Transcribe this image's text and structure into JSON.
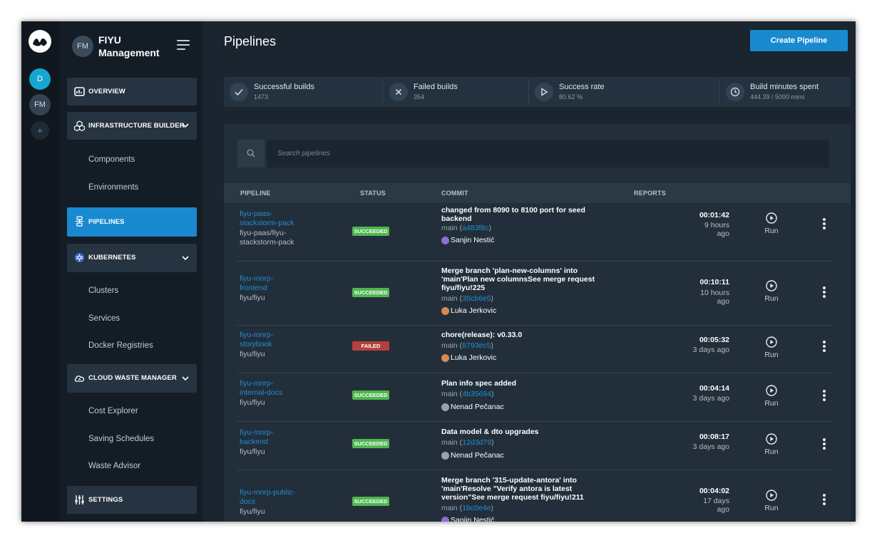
{
  "rail": {
    "workspaces": [
      "D",
      "FM"
    ],
    "add_label": "+"
  },
  "sidebar": {
    "org_initials": "FM",
    "org_name": "FIYU Management",
    "nav": {
      "overview": "OVERVIEW",
      "infrastructure_builder": "INFRASTRUCTURE BUILDER",
      "components": "Components",
      "environments": "Environments",
      "pipelines": "PIPELINES",
      "kubernetes": "KUBERNETES",
      "clusters": "Clusters",
      "services": "Services",
      "docker_registries": "Docker Registries",
      "cloud_waste_manager": "CLOUD WASTE MANAGER",
      "cost_explorer": "Cost Explorer",
      "saving_schedules": "Saving Schedules",
      "waste_advisor": "Waste Advisor",
      "settings": "SETTINGS"
    },
    "active_item": "pipelines"
  },
  "header": {
    "title": "Pipelines",
    "create_button": "Create Pipeline"
  },
  "stats": [
    {
      "icon": "check-icon",
      "label": "Successful builds",
      "value": "1473"
    },
    {
      "icon": "x-icon",
      "label": "Failed builds",
      "value": "354"
    },
    {
      "icon": "play-icon",
      "label": "Success rate",
      "value": "80.62 %"
    },
    {
      "icon": "clock-icon",
      "label": "Build minutes spent",
      "value": "444.39 / 5000 mins"
    }
  ],
  "search": {
    "placeholder": "Search pipelines",
    "value": ""
  },
  "table": {
    "columns": [
      "PIPELINE",
      "STATUS",
      "COMMIT",
      "REPORTS"
    ],
    "rows": [
      {
        "name_lines": [
          "fiyu-paas-",
          "stackstorm-pack"
        ],
        "repo_lines": [
          "fiyu-paas/fiyu-",
          "stackstorm-pack"
        ],
        "status": "SUCCEEDED",
        "commit_lines": [
          "changed from 8090 to 8100 port for seed",
          "backend"
        ],
        "branch": "main",
        "hash": "a483f8c",
        "author": "Sanjin Nestić",
        "author_color": "#8b6fd6",
        "duration": "00:01:42",
        "ago_lines": [
          "9 hours",
          "ago"
        ],
        "run_label": "Run"
      },
      {
        "name_lines": [
          "fiyu-mnrp-",
          "frontend"
        ],
        "repo_lines": [
          "fiyu/fiyu"
        ],
        "status": "SUCCEEDED",
        "commit_lines": [
          "Merge branch 'plan-new-columns' into",
          "'main'Plan new columnsSee merge request",
          "fiyu/fiyu!225"
        ],
        "branch": "main",
        "hash": "35cb6e5",
        "author": "Luka Jerkovic",
        "author_color": "#d68a4f",
        "duration": "00:10:11",
        "ago_lines": [
          "10 hours",
          "ago"
        ],
        "run_label": "Run"
      },
      {
        "name_lines": [
          "fiyu-mnrp-",
          "storybook"
        ],
        "repo_lines": [
          "fiyu/fiyu"
        ],
        "status": "FAILED",
        "commit_lines": [
          "chore(release): v0.33.0"
        ],
        "branch": "main",
        "hash": "8793ec5",
        "author": "Luka Jerkovic",
        "author_color": "#d68a4f",
        "duration": "00:05:32",
        "ago_lines": [
          "3 days ago"
        ],
        "run_label": "Run"
      },
      {
        "name_lines": [
          "fiyu-mnrp-",
          "internal-docs"
        ],
        "repo_lines": [
          "fiyu/fiyu"
        ],
        "status": "SUCCEEDED",
        "commit_lines": [
          "Plan info spec added"
        ],
        "branch": "main",
        "hash": "4b35694",
        "author": "Nenad Pečanac",
        "author_color": "#9aa1a8",
        "duration": "00:04:14",
        "ago_lines": [
          "3 days ago"
        ],
        "run_label": "Run"
      },
      {
        "name_lines": [
          "fiyu-mnrp-",
          "backend"
        ],
        "repo_lines": [
          "fiyu/fiyu"
        ],
        "status": "SUCCEEDED",
        "commit_lines": [
          "Data model & dto upgrades"
        ],
        "branch": "main",
        "hash": "12d3d79",
        "author": "Nenad Pečanac",
        "author_color": "#9aa1a8",
        "duration": "00:08:17",
        "ago_lines": [
          "3 days ago"
        ],
        "run_label": "Run"
      },
      {
        "name_lines": [
          "fiyu-mnrp-public-",
          "docs"
        ],
        "repo_lines": [
          "fiyu/fiyu"
        ],
        "status": "SUCCEEDED",
        "commit_lines": [
          "Merge branch '315-update-antora' into",
          "'main'Resolve \"Verify antora is latest",
          "version\"See merge request fiyu/fiyu!211"
        ],
        "branch": "main",
        "hash": "1bc0e4e",
        "author": "Sanjin Nestić",
        "author_color": "#8b6fd6",
        "duration": "00:04:02",
        "ago_lines": [
          "17 days",
          "ago"
        ],
        "run_label": "Run"
      }
    ]
  },
  "colors": {
    "accent": "#1a8ad0",
    "succeeded": "#4fb64f",
    "failed": "#b4413b",
    "link": "#1f8fd3"
  }
}
